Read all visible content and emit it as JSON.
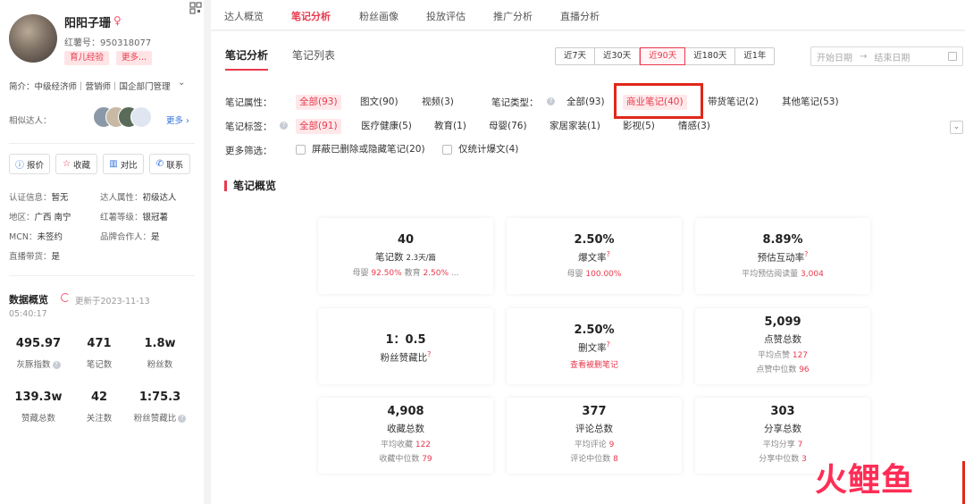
{
  "profile": {
    "name": "阳阳子珊",
    "red_id": "红薯号：950318077",
    "tags": [
      "育儿经验",
      "更多..."
    ],
    "intro": "简介：中级经济师｜营销师｜国企部门管理",
    "similar_label": "相似达人：",
    "similar_more": "更多",
    "actions": [
      "报价",
      "收藏",
      "对比",
      "联系"
    ],
    "info": [
      {
        "label": "认证信息：",
        "value": "暂无"
      },
      {
        "label": "达人属性：",
        "value": "初级达人"
      },
      {
        "label": "地区：",
        "value": "广西 南宁"
      },
      {
        "label": "红薯等级：",
        "value": "银冠薯"
      },
      {
        "label": "MCN：",
        "value": "未签约"
      },
      {
        "label": "品牌合作人：",
        "value": "是"
      },
      {
        "label": "直播带货：",
        "value": "是"
      }
    ],
    "data_title": "数据概览",
    "update_prefix": "更新于2023-11-13",
    "update_time": "05:40:17",
    "stats": [
      {
        "value": "495.97",
        "label": "灰豚指数"
      },
      {
        "value": "471",
        "label": "笔记数"
      },
      {
        "value": "1.8w",
        "label": "粉丝数"
      },
      {
        "value": "139.3w",
        "label": "赞藏总数"
      },
      {
        "value": "42",
        "label": "关注数"
      },
      {
        "value": "1:75.3",
        "label": "粉丝赞藏比"
      }
    ]
  },
  "top_tabs": [
    "达人概览",
    "笔记分析",
    "粉丝画像",
    "投放评估",
    "推广分析",
    "直播分析"
  ],
  "sub_tabs": [
    "笔记分析",
    "笔记列表"
  ],
  "ranges": [
    "近7天",
    "近30天",
    "近90天",
    "近180天",
    "近1年"
  ],
  "date": {
    "start": "开始日期",
    "arrow": "→",
    "end": "结束日期"
  },
  "filters": {
    "attr_label": "笔记属性：",
    "attr": [
      "全部(93)",
      "图文(90)",
      "视频(3)"
    ],
    "type_label": "笔记类型：",
    "type": [
      "全部(93)",
      "商业笔记(40)",
      "带货笔记(2)",
      "其他笔记(53)"
    ],
    "tag_label": "笔记标签：",
    "tags": [
      "全部(91)",
      "医疗健康(5)",
      "教育(1)",
      "母婴(76)",
      "家居家装(1)",
      "影视(5)",
      "情感(3)"
    ],
    "more_label": "更多筛选：",
    "more": [
      "屏蔽已删除或隐藏笔记(20)",
      "仅统计爆文(4)"
    ]
  },
  "section_title": "笔记概览",
  "cards": [
    {
      "value": "40",
      "unit": "2.3天/篇",
      "label": "笔记数",
      "lines": [
        {
          "pre": "母婴 ",
          "hl": "92.50%",
          "mid": " 教育 ",
          "hl2": "2.50%",
          "post": " ..."
        }
      ]
    },
    {
      "value": "2.50%",
      "label": "爆文率",
      "lines": [
        {
          "pre": "母婴 ",
          "hl": "100.00%"
        }
      ]
    },
    {
      "value": "8.89%",
      "label": "预估互动率",
      "lines": [
        {
          "pre": "平均预估阅读量 ",
          "hl": "3,004"
        }
      ]
    },
    {
      "value": "1：0.5",
      "label": "粉丝赞藏比",
      "lines": []
    },
    {
      "value": "2.50%",
      "label": "删文率",
      "link": "查看被删笔记",
      "lines": []
    },
    {
      "value": "5,099",
      "label": "点赞总数",
      "lines": [
        {
          "pre": "平均点赞 ",
          "hl": "127"
        },
        {
          "pre": "点赞中位数 ",
          "hl": "96"
        }
      ]
    },
    {
      "value": "4,908",
      "label": "收藏总数",
      "lines": [
        {
          "pre": "平均收藏 ",
          "hl": "122"
        },
        {
          "pre": "收藏中位数 ",
          "hl": "79"
        }
      ]
    },
    {
      "value": "377",
      "label": "评论总数",
      "lines": [
        {
          "pre": "平均评论 ",
          "hl": "9"
        },
        {
          "pre": "评论中位数 ",
          "hl": "8"
        }
      ]
    },
    {
      "value": "303",
      "label": "分享总数",
      "lines": [
        {
          "pre": "平均分享 ",
          "hl": "7"
        },
        {
          "pre": "分享中位数 ",
          "hl": "3"
        }
      ]
    }
  ],
  "watermark": "火鲤鱼",
  "colors": {
    "accent": "#e8394d",
    "link": "#2f6fde",
    "highlight_box": "#e0271a"
  }
}
